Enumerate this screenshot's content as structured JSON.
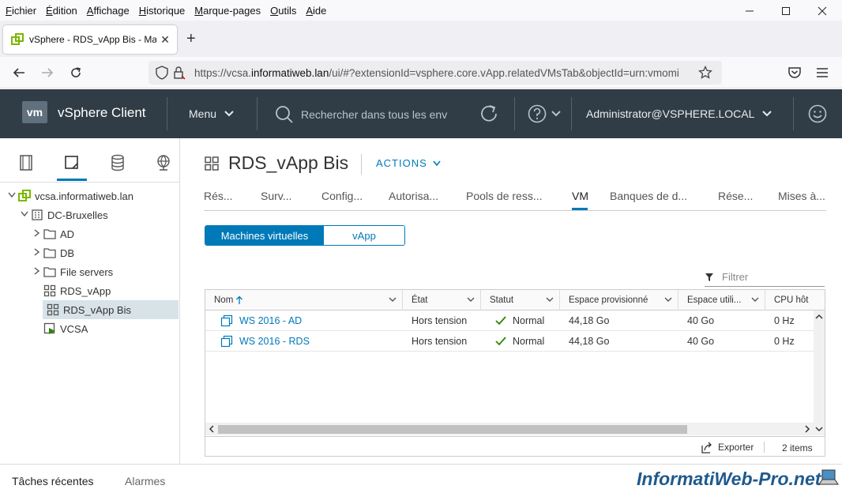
{
  "menubar": {
    "items": [
      {
        "u": "F",
        "rest": "ichier"
      },
      {
        "u": "É",
        "rest": "dition"
      },
      {
        "u": "A",
        "rest": "ffichage"
      },
      {
        "u": "H",
        "rest": "istorique"
      },
      {
        "u": "M",
        "rest": "arque-pages"
      },
      {
        "u": "O",
        "rest": "utils"
      },
      {
        "u": "A",
        "rest": "ide"
      }
    ]
  },
  "browser": {
    "tab_title": "vSphere - RDS_vApp Bis - Machi",
    "url_prefix": "https://vcsa.",
    "url_host": "informatiweb.lan",
    "url_rest": "/ui/#?extensionId=vsphere.core.vApp.relatedVMsTab&objectId=urn:vmomi"
  },
  "vsphere": {
    "logo": "vm",
    "app_name": "vSphere Client",
    "menu_label": "Menu",
    "search_placeholder": "Rechercher dans tous les env",
    "user": "Administrator@VSPHERE.LOCAL"
  },
  "tree": [
    {
      "label": "vcsa.informatiweb.lan",
      "icon": "vcenter-icon",
      "level": 0,
      "arrow": "expanded"
    },
    {
      "label": "DC-Bruxelles",
      "icon": "datacenter-icon",
      "level": 1,
      "arrow": "expanded"
    },
    {
      "label": "AD",
      "icon": "folder-icon",
      "level": 2,
      "arrow": "collapsed"
    },
    {
      "label": "DB",
      "icon": "folder-icon",
      "level": 2,
      "arrow": "collapsed"
    },
    {
      "label": "File servers",
      "icon": "folder-icon",
      "level": 2,
      "arrow": "collapsed"
    },
    {
      "label": "RDS_vApp",
      "icon": "vapp-icon",
      "level": 2,
      "arrow": "none"
    },
    {
      "label": "RDS_vApp Bis",
      "icon": "vapp-icon",
      "level": 2,
      "arrow": "none",
      "selected": true
    },
    {
      "label": "VCSA",
      "icon": "vm-on-icon",
      "level": 2,
      "arrow": "none"
    }
  ],
  "main": {
    "title": "RDS_vApp Bis",
    "actions_label": "ACTIONS",
    "tabs": [
      "Rés...",
      "Surv...",
      "Config...",
      "Autorisa...",
      "Pools de ress...",
      "VM",
      "Banques de d...",
      "Rése...",
      "Mises à..."
    ],
    "seg_vms": "Machines virtuelles",
    "seg_vapp": "vApp",
    "filter_placeholder": "Filtrer",
    "columns": [
      "Nom",
      "État",
      "Statut",
      "Espace provisionné",
      "Espace utili...",
      "CPU hôt"
    ],
    "rows": [
      {
        "name": "WS 2016 - AD",
        "state": "Hors tension",
        "status": "Normal",
        "provisioned": "44,18 Go",
        "used": "40 Go",
        "cpu": "0 Hz"
      },
      {
        "name": "WS 2016 - RDS",
        "state": "Hors tension",
        "status": "Normal",
        "provisioned": "44,18 Go",
        "used": "40 Go",
        "cpu": "0 Hz"
      }
    ],
    "export_label": "Exporter",
    "items_count": "2 items"
  },
  "bottom": {
    "recent_tasks": "Tâches récentes",
    "alarms": "Alarmes",
    "watermark": "InformatiWeb-Pro.net"
  },
  "colors": {
    "accent": "#0079b8",
    "header_bg": "#313d46",
    "status_ok": "#2f8400"
  }
}
